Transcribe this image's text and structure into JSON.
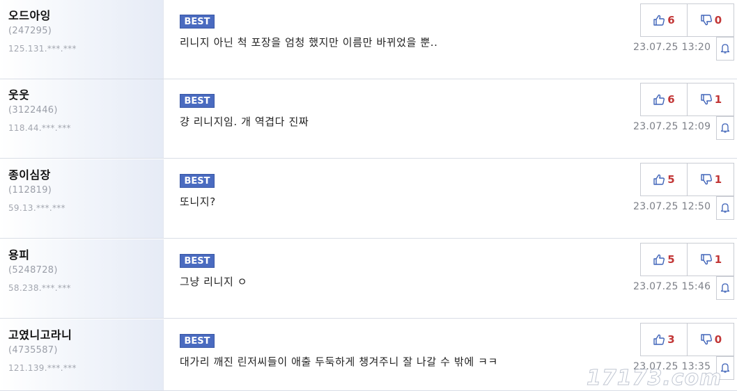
{
  "comments": [
    {
      "nick": "오드아잉",
      "uid": "(247295)",
      "ip": "125.131.***.***",
      "badge": "BEST",
      "text": "리니지 아닌 척 포장을 엄청 했지만 이름만 바뀌었을 뿐..",
      "up": "6",
      "down": "0",
      "date": "23.07.25 13:20"
    },
    {
      "nick": "웃웃",
      "uid": "(3122446)",
      "ip": "118.44.***.***",
      "badge": "BEST",
      "text": "걍 리니지임. 개 역겹다 진짜",
      "up": "6",
      "down": "1",
      "date": "23.07.25 12:09"
    },
    {
      "nick": "종이심장",
      "uid": "(112819)",
      "ip": "59.13.***.***",
      "badge": "BEST",
      "text": "또니지?",
      "up": "5",
      "down": "1",
      "date": "23.07.25 12:50"
    },
    {
      "nick": "용피",
      "uid": "(5248728)",
      "ip": "58.238.***.***",
      "badge": "BEST",
      "text": "그냥 리니지 ㅇ",
      "up": "5",
      "down": "1",
      "date": "23.07.25 15:46"
    },
    {
      "nick": "고였니고라니",
      "uid": "(4735587)",
      "ip": "121.139.***.***",
      "badge": "BEST",
      "text": "대가리 깨진 린저씨들이 애출 두둑하게 챙겨주니 잘 나갈 수 밖에 ㅋㅋ",
      "up": "3",
      "down": "0",
      "date": "23.07.25 13:35"
    }
  ],
  "watermark": "17173.com",
  "colors": {
    "badge": "#4a6bc0",
    "count": "#c23636",
    "icon": "#3f63b8"
  },
  "icons": {
    "up": "thumbs-up-icon",
    "down": "thumbs-down-icon",
    "report": "bell-icon"
  }
}
